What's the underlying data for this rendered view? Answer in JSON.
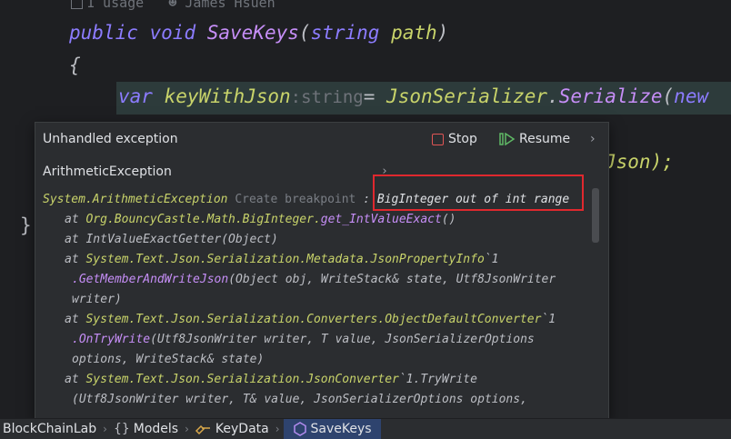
{
  "editor": {
    "hint_usages": "1 usage",
    "hint_author": "James Hsuen",
    "line1": {
      "kw1": "public",
      "kw2": "void",
      "fn": "SaveKeys",
      "open": "(",
      "type": "string",
      "param": "path",
      "close": ")"
    },
    "line2": "{",
    "line3": {
      "kw": "var",
      "name": "keyWithJson",
      "type_hint": ":string",
      "eq": "= ",
      "cls": "JsonSerializer",
      "dot": ".",
      "fn": "Serialize",
      "open": "(",
      "next": "new"
    },
    "line4_tail": "Json);",
    "line5": "}"
  },
  "popup": {
    "title": "Unhandled exception",
    "stop_label": "Stop",
    "resume_label": "Resume",
    "exception_name": "ArithmeticException",
    "first_line": {
      "cls": "System.ArithmeticException",
      "breakpoint": "Create breakpoint",
      "sep": ":",
      "message": "BigInteger out of int range"
    },
    "stack": [
      {
        "at": "at",
        "cls": "Org.BouncyCastle.Math.BigInteger.",
        "fn": "get_IntValueExact",
        "rest": "()"
      },
      {
        "at": "at",
        "cls": "",
        "fn": "",
        "rest": "IntValueExactGetter(Object)"
      },
      {
        "at": "at",
        "cls": "System.Text.Json.Serialization.Metadata.JsonPropertyInfo",
        "fn": "",
        "rest": "`1"
      },
      {
        "at": "",
        "cls": "",
        "fn": ".GetMemberAndWriteJson",
        "rest": "(Object obj, WriteStack& state, Utf8JsonWriter"
      },
      {
        "at": "",
        "cls": "",
        "fn": "",
        "rest": "writer)"
      },
      {
        "at": "at",
        "cls": "System.Text.Json.Serialization.Converters.ObjectDefaultConverter",
        "fn": "",
        "rest": "`1"
      },
      {
        "at": "",
        "cls": "",
        "fn": ".OnTryWrite",
        "rest": "(Utf8JsonWriter writer, T value, JsonSerializerOptions"
      },
      {
        "at": "",
        "cls": "",
        "fn": "",
        "rest": "options, WriteStack& state)"
      },
      {
        "at": "at",
        "cls": "System.Text.Json.Serialization.JsonConverter",
        "fn": "",
        "rest": "`1.TryWrite"
      },
      {
        "at": "",
        "cls": "",
        "fn": "",
        "rest": "(Utf8JsonWriter writer, T& value, JsonSerializerOptions options,"
      }
    ]
  },
  "breadcrumb": {
    "items": [
      "BlockChainLab",
      "Models",
      "KeyData",
      "SaveKeys"
    ],
    "models_icon": "{}"
  },
  "colors": {
    "accent": "#2e436e",
    "highlight_box": "#e0282e",
    "stop": "#e05555",
    "resume": "#5fb865"
  }
}
